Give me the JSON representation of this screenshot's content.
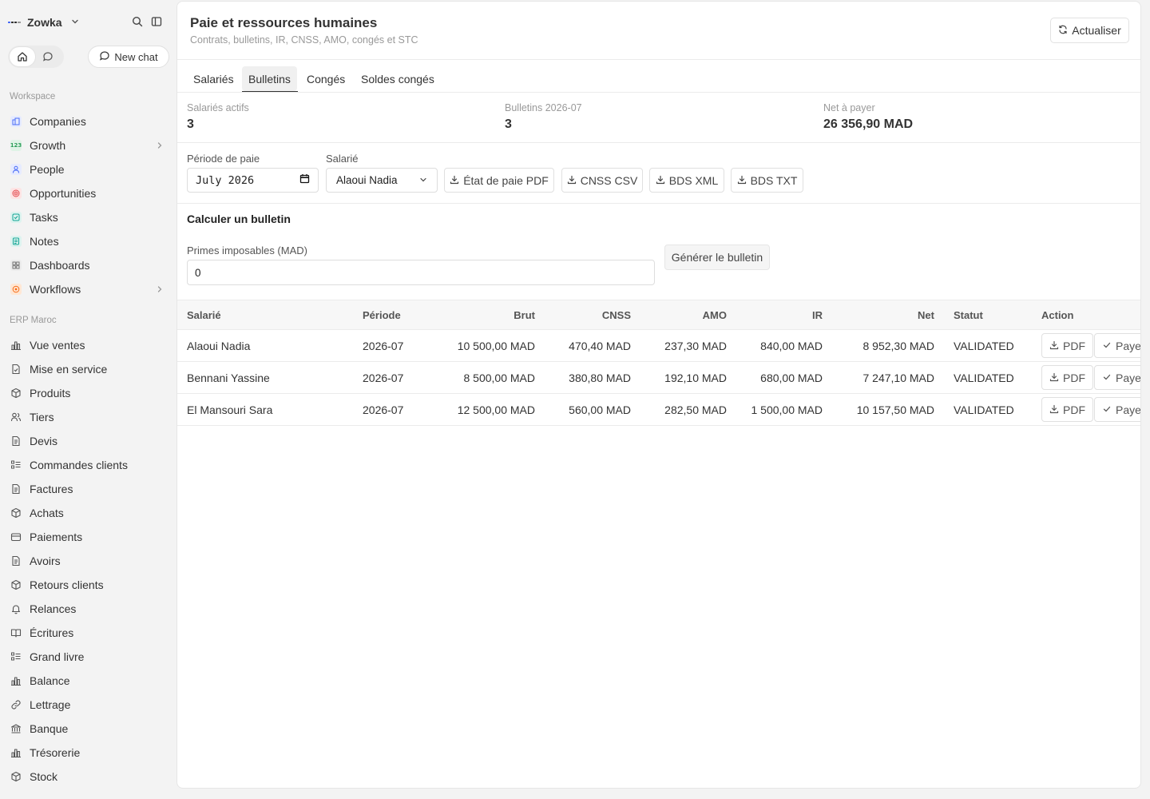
{
  "workspace": {
    "name": "Zowka"
  },
  "sidebar_top": {
    "new_chat_label": "New chat"
  },
  "sections": {
    "workspace_label": "Workspace",
    "erp_label": "ERP Maroc"
  },
  "workspace_items": [
    {
      "label": "Companies",
      "icon": "building-icon",
      "color": "#4a6cf7"
    },
    {
      "label": "Growth",
      "icon": "growth-123-icon",
      "color": "#2e9e5b"
    },
    {
      "label": "People",
      "icon": "person-icon",
      "color": "#4a6cf7"
    },
    {
      "label": "Opportunities",
      "icon": "target-icon",
      "color": "#e5484d"
    },
    {
      "label": "Tasks",
      "icon": "checkbox-icon",
      "color": "#12a594"
    },
    {
      "label": "Notes",
      "icon": "note-icon",
      "color": "#12a594"
    },
    {
      "label": "Dashboards",
      "icon": "dashboard-icon",
      "color": "#777777"
    },
    {
      "label": "Workflows",
      "icon": "workflow-icon",
      "color": "#f76b15"
    }
  ],
  "erp_items": [
    {
      "label": "Vue ventes",
      "icon": "bar-chart-icon"
    },
    {
      "label": "Mise en service",
      "icon": "document-check-icon"
    },
    {
      "label": "Produits",
      "icon": "box-icon"
    },
    {
      "label": "Tiers",
      "icon": "users-icon"
    },
    {
      "label": "Devis",
      "icon": "document-icon"
    },
    {
      "label": "Commandes clients",
      "icon": "list-check-icon"
    },
    {
      "label": "Factures",
      "icon": "document-icon"
    },
    {
      "label": "Achats",
      "icon": "box-icon"
    },
    {
      "label": "Paiements",
      "icon": "wallet-icon"
    },
    {
      "label": "Avoirs",
      "icon": "document-icon"
    },
    {
      "label": "Retours clients",
      "icon": "box-icon"
    },
    {
      "label": "Relances",
      "icon": "bell-icon"
    },
    {
      "label": "Écritures",
      "icon": "book-icon"
    },
    {
      "label": "Grand livre",
      "icon": "list-check-icon"
    },
    {
      "label": "Balance",
      "icon": "bar-chart-icon"
    },
    {
      "label": "Lettrage",
      "icon": "link-icon"
    },
    {
      "label": "Banque",
      "icon": "bank-icon"
    },
    {
      "label": "Trésorerie",
      "icon": "bar-chart-icon"
    },
    {
      "label": "Stock",
      "icon": "box-icon"
    }
  ],
  "page": {
    "title": "Paie et ressources humaines",
    "subtitle": "Contrats, bulletins, IR, CNSS, AMO, congés et STC",
    "refresh_label": "Actualiser"
  },
  "tabs": [
    "Salariés",
    "Bulletins",
    "Congés",
    "Soldes congés"
  ],
  "active_tab": "Bulletins",
  "stats": [
    {
      "label": "Salariés actifs",
      "value": "3"
    },
    {
      "label": "Bulletins 2026-07",
      "value": "3"
    },
    {
      "label": "Net à payer",
      "value": "26 356,90 MAD"
    }
  ],
  "filters": {
    "period_label": "Période de paie",
    "period_value": "July 2026",
    "employee_label": "Salarié",
    "employee_value": "Alaoui Nadia"
  },
  "exports": [
    "État de paie PDF",
    "CNSS CSV",
    "BDS XML",
    "BDS TXT"
  ],
  "calc": {
    "title": "Calculer un bulletin",
    "bonus_label": "Primes imposables (MAD)",
    "bonus_value": "0",
    "generate_label": "Générer le bulletin"
  },
  "table": {
    "headers": [
      "Salarié",
      "Période",
      "Brut",
      "CNSS",
      "AMO",
      "IR",
      "Net",
      "Statut",
      "Action"
    ],
    "rows": [
      {
        "employee": "Alaoui Nadia",
        "period": "2026-07",
        "gross": "10 500,00 MAD",
        "cnss": "470,40 MAD",
        "amo": "237,30 MAD",
        "ir": "840,00 MAD",
        "net": "8 952,30 MAD",
        "status": "VALIDATED"
      },
      {
        "employee": "Bennani Yassine",
        "period": "2026-07",
        "gross": "8 500,00 MAD",
        "cnss": "380,80 MAD",
        "amo": "192,10 MAD",
        "ir": "680,00 MAD",
        "net": "7 247,10 MAD",
        "status": "VALIDATED"
      },
      {
        "employee": "El Mansouri Sara",
        "period": "2026-07",
        "gross": "12 500,00 MAD",
        "cnss": "560,00 MAD",
        "amo": "282,50 MAD",
        "ir": "1 500,00 MAD",
        "net": "10 157,50 MAD",
        "status": "VALIDATED"
      }
    ],
    "pdf_label": "PDF",
    "pay_label": "Payer"
  }
}
